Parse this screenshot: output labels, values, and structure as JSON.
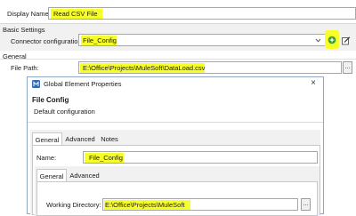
{
  "colors": {
    "highlight": "#f7ff2a",
    "panel_bg": "#f1f1f1",
    "dialog_border": "#8fa6c4",
    "add_icon": "#3a9b28"
  },
  "display_name": {
    "label": "Display Name:",
    "value": "Read CSV File"
  },
  "basic_settings": {
    "heading": "Basic Settings",
    "connector_label": "Connector configuration:",
    "connector_value": "File_Config",
    "dropdown_icon": "chevron-down-icon",
    "add_icon": "plus-icon",
    "edit_icon": "edit-icon"
  },
  "general": {
    "heading": "General",
    "file_path_label": "File Path:",
    "file_path_value": "E:\\Office\\Projects\\MuleSoft\\DataLoad.csv",
    "browse_label": "..."
  },
  "dialog": {
    "title": "Global Element Properties",
    "close_label": "×",
    "heading": "File Config",
    "subheading": "Default configuration",
    "tabs": [
      {
        "label": "General"
      },
      {
        "label": "Advanced"
      },
      {
        "label": "Notes"
      }
    ],
    "name_label": "Name:",
    "name_value": "File_Config",
    "inner_tabs": [
      {
        "label": "General"
      },
      {
        "label": "Advanced"
      }
    ],
    "working_dir_label": "Working Directory:",
    "working_dir_value": "E:\\Office\\Projects\\MuleSoft",
    "browse_label": "..."
  }
}
